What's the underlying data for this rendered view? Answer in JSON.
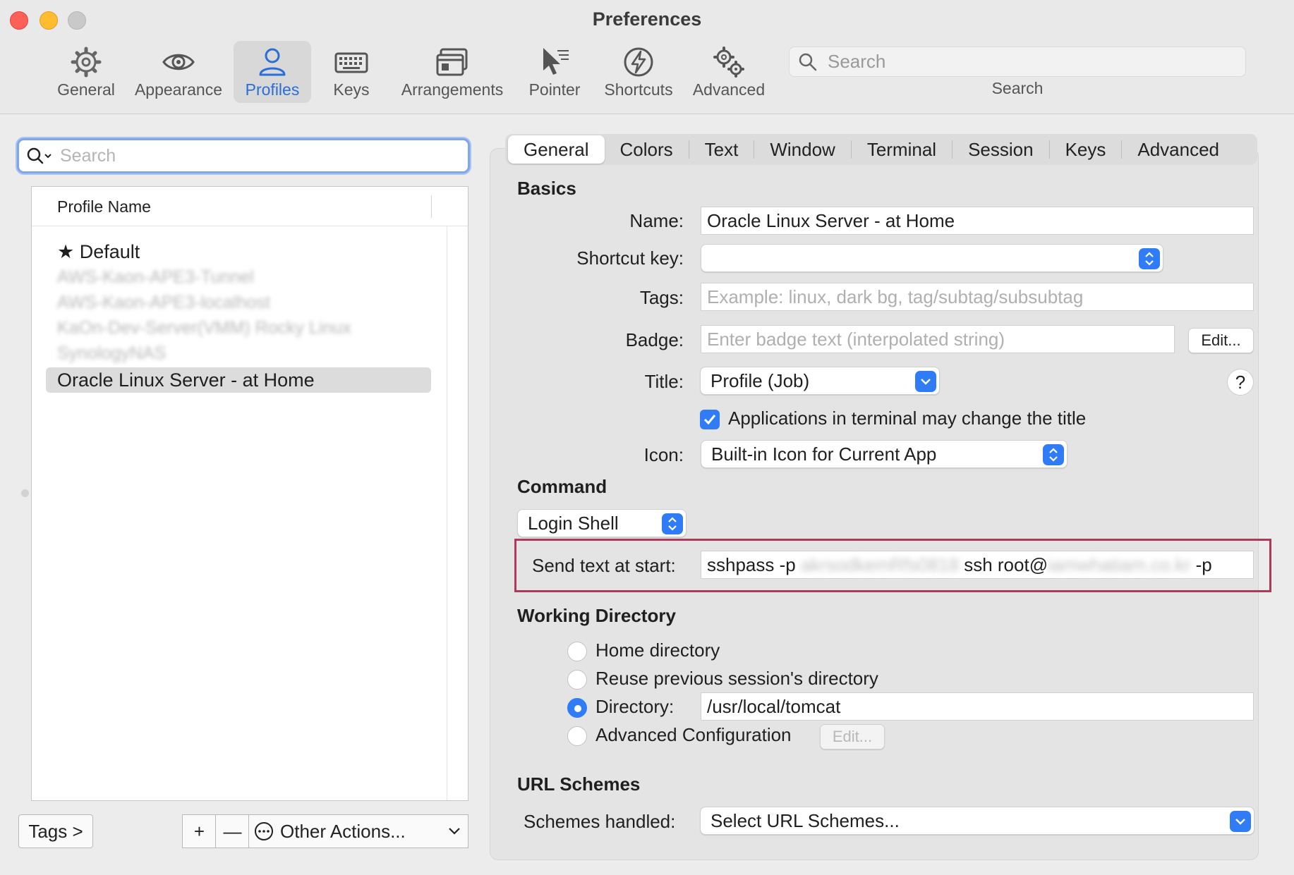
{
  "window": {
    "title": "Preferences"
  },
  "toolbar": {
    "items": [
      {
        "label": "General",
        "icon": "gear-icon"
      },
      {
        "label": "Appearance",
        "icon": "eye-icon"
      },
      {
        "label": "Profiles",
        "icon": "person-icon",
        "active": true
      },
      {
        "label": "Keys",
        "icon": "keyboard-icon"
      },
      {
        "label": "Arrangements",
        "icon": "window-icon"
      },
      {
        "label": "Pointer",
        "icon": "pointer-icon"
      },
      {
        "label": "Shortcuts",
        "icon": "lightning-icon"
      },
      {
        "label": "Advanced",
        "icon": "gears-icon"
      }
    ],
    "search_placeholder": "Search",
    "search_label": "Search"
  },
  "profiles": {
    "search_placeholder": "Search",
    "column_header": "Profile Name",
    "items": [
      {
        "name": "Default",
        "default": true
      },
      {
        "name": "AWS-Kaon-APE3-Tunnel",
        "blurred": true
      },
      {
        "name": "AWS-Kaon-APE3-localhost",
        "blurred": true
      },
      {
        "name": "KaOn-Dev-Server(VMM) Rocky Linux",
        "blurred": true
      },
      {
        "name": "SynologyNAS",
        "blurred": true
      },
      {
        "name": "Oracle Linux Server - at Home",
        "selected": true
      }
    ],
    "tags_button": "Tags >",
    "add_button": "+",
    "remove_button": "—",
    "other_actions": "Other Actions..."
  },
  "tabs": [
    "General",
    "Colors",
    "Text",
    "Window",
    "Terminal",
    "Session",
    "Keys",
    "Advanced"
  ],
  "basics": {
    "heading": "Basics",
    "name_label": "Name:",
    "name_value": "Oracle Linux Server - at Home",
    "shortcut_label": "Shortcut key:",
    "shortcut_value": "",
    "tags_label": "Tags:",
    "tags_placeholder": "Example: linux, dark bg, tag/subtag/subsubtag",
    "badge_label": "Badge:",
    "badge_placeholder": "Enter badge text (interpolated string)",
    "badge_edit": "Edit...",
    "title_label": "Title:",
    "title_value": "Profile (Job)",
    "help": "?",
    "apps_change_title": "Applications in terminal may change the title",
    "apps_change_title_checked": true,
    "icon_label": "Icon:",
    "icon_value": "Built-in Icon for Current App"
  },
  "command": {
    "heading": "Command",
    "mode": "Login Shell",
    "send_text_label": "Send text at start:",
    "send_text_part1": "sshpass -p",
    "send_text_secret": "akrsodkemRfs0818",
    "send_text_part2": "ssh root@",
    "send_text_host": "iamwhatiam.co.kr",
    "send_text_part3": "-p"
  },
  "working_directory": {
    "heading": "Working Directory",
    "options": [
      "Home directory",
      "Reuse previous session's directory",
      "Directory:",
      "Advanced Configuration"
    ],
    "selected": "Directory:",
    "directory_value": "/usr/local/tomcat",
    "advanced_edit": "Edit..."
  },
  "url_schemes": {
    "heading": "URL Schemes",
    "label": "Schemes handled:",
    "value": "Select URL Schemes..."
  },
  "colors": {
    "accent": "#2f7cf6",
    "highlight": "#b0385a",
    "active_tab_text": "#2a6fd6"
  }
}
